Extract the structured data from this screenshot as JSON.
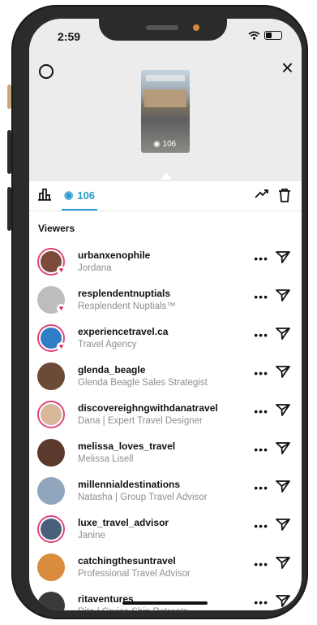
{
  "status": {
    "time": "2:59"
  },
  "story": {
    "view_count": "106"
  },
  "tabs": {
    "views_count": "106"
  },
  "viewers_title": "Viewers",
  "viewers": [
    {
      "username": "urbanxenophile",
      "name": "Jordana",
      "color": "#7a4b3a",
      "ring": true,
      "heart": true
    },
    {
      "username": "resplendentnuptials",
      "name": "Resplendent Nuptials™",
      "color": "#bdbdbd",
      "ring": false,
      "heart": true
    },
    {
      "username": "experiencetravel.ca",
      "name": "Travel Agency",
      "color": "#2f7dc6",
      "ring": true,
      "heart": true
    },
    {
      "username": "glenda_beagle",
      "name": "Glenda Beagle Sales Strategist",
      "color": "#6b4a36",
      "ring": false,
      "heart": false
    },
    {
      "username": "discovereighngwithdanatravel",
      "name": "Dana | Expert Travel Designer",
      "color": "#d8b79a",
      "ring": true,
      "heart": false
    },
    {
      "username": "melissa_loves_travel",
      "name": "Melissa Lisell",
      "color": "#5a3a2c",
      "ring": false,
      "heart": false
    },
    {
      "username": "millennialdestinations",
      "name": "Natasha | Group Travel Advisor",
      "color": "#8fa6bd",
      "ring": false,
      "heart": false
    },
    {
      "username": "luxe_travel_advisor",
      "name": "Janine",
      "color": "#49607a",
      "ring": true,
      "heart": false
    },
    {
      "username": "catchingthesuntravel",
      "name": "Professional Travel Advisor",
      "color": "#d98b3e",
      "ring": false,
      "heart": false
    },
    {
      "username": "ritaventures",
      "name": "Rita | Cruise Ship Retreats",
      "color": "#3a3a3a",
      "ring": false,
      "heart": false
    }
  ]
}
